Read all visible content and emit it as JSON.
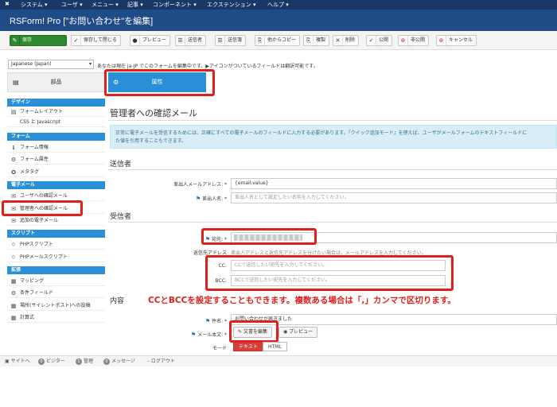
{
  "topmenu": {
    "logo_icon": "joomla-icon",
    "items": [
      "システム ▾",
      "ユーザ ▾",
      "メニュー ▾",
      "記事 ▾",
      "コンポーネント ▾",
      "エクステンション ▾",
      "ヘルプ ▾"
    ]
  },
  "titlebar": {
    "title": "RSForm! Pro [\"お問い合わせ\"を編集]"
  },
  "toolbar": {
    "buttons": [
      {
        "icon": "save-icon",
        "glyph": "✎",
        "label": "保存"
      },
      {
        "icon": "check-icon",
        "glyph": "✓",
        "label": "保存して閉じる"
      },
      {
        "icon": "preview-icon",
        "glyph": "●",
        "label": "プレビュー"
      },
      {
        "icon": "list-icon",
        "glyph": "☰",
        "label": "送信者"
      },
      {
        "icon": "list-icon",
        "glyph": "☰",
        "label": "送信簿"
      },
      {
        "icon": "copy-icon",
        "glyph": "⎘",
        "label": "他からコピー"
      },
      {
        "icon": "copy-icon",
        "glyph": "⎘",
        "label": "複製"
      },
      {
        "icon": "close-icon",
        "glyph": "✕",
        "label": "削除"
      },
      {
        "icon": "check-icon",
        "glyph": "✓",
        "label": "公開"
      },
      {
        "icon": "unpublish-icon",
        "glyph": "⊗",
        "label": "非公開"
      },
      {
        "icon": "cancel-icon",
        "glyph": "⊗",
        "label": "キャンセル"
      }
    ]
  },
  "language": {
    "selected": "Japanese (Japan)"
  },
  "info_text": "あなたは現在 ja-JP でこのフォームを編集中です。▶アイコンがついているフィールドは翻訳可能です。",
  "left": {
    "parts_tab": "部品",
    "sections": [
      {
        "title": "デザイン",
        "items": [
          {
            "icon": "layout-icon",
            "glyph": "▤",
            "label": "フォームレイアウト"
          },
          {
            "icon": "css-icon",
            "glyph": "",
            "label": "CSS と Javascript"
          }
        ]
      },
      {
        "title": "フォーム",
        "items": [
          {
            "icon": "info-icon",
            "glyph": "ℹ",
            "label": "フォーム情報"
          },
          {
            "icon": "gear-icon",
            "glyph": "⚙",
            "label": "フォーム属性"
          },
          {
            "icon": "globe-icon",
            "glyph": "✪",
            "label": "メタタグ"
          }
        ]
      },
      {
        "title": "電子メール",
        "items": [
          {
            "icon": "mail-icon",
            "glyph": "✉",
            "label": "ユーザへの確認メール"
          },
          {
            "icon": "mail-icon",
            "glyph": "✉",
            "label": "管理者への確認メール"
          },
          {
            "icon": "mail-icon",
            "glyph": "✉",
            "label": "追加の電子メール"
          }
        ]
      },
      {
        "title": "スクリプト",
        "items": [
          {
            "icon": "code-icon",
            "glyph": "⟨⟩",
            "label": "PHPスクリプト"
          },
          {
            "icon": "code-icon",
            "glyph": "⟨⟩",
            "label": "PHPメールスクリプト"
          }
        ]
      },
      {
        "title": "拡張",
        "items": [
          {
            "icon": "map-icon",
            "glyph": "▦",
            "label": "マッピング"
          },
          {
            "icon": "conditional-icon",
            "glyph": "⚙",
            "label": "条件フィールド"
          },
          {
            "icon": "post-icon",
            "glyph": "▦",
            "label": "場所(サイレントポスト)への投稿"
          },
          {
            "icon": "calculator-icon",
            "glyph": "▦",
            "label": "計算式"
          }
        ]
      }
    ]
  },
  "props_tab": "属性",
  "main": {
    "heading": "管理者への確認メール",
    "alert_line1": "正常に電子メールを受信するためには、正確にすべての電子メールのフィールドに入力する必要があります。『クイック追加モード』を使えば、ユーザがメールフォームのテキストフィールドに",
    "alert_line2": "た値を引用することもできます。",
    "sender_heading": "送信者",
    "from_label": "差出人メールアドレス: *",
    "from_value": "{email:value}",
    "fromname_label": "差出人名: *",
    "fromname_placeholder": "差出人名として設定したい名前を入力してください。",
    "recipient_heading": "受信者",
    "to_label": "宛先: *",
    "replyto_label": "返信先アドレス",
    "replyto_placeholder": "差出人アドレスと返信先アドレスを分けたい場合は、メールアドレスを入力してください。",
    "cc_label": "CC:",
    "cc_placeholder": "CCで送信したい宛先を入力してください。",
    "bcc_label": "BCC:",
    "bcc_placeholder": "BCCで送信したい宛先を入力してください。",
    "content_heading": "内容",
    "annotation": "CCとBCCを設定することもできます。複数ある場合は「,」カンマで区切ります。",
    "subject_label": "件名: *",
    "subject_value": "お問い合わせが届きました",
    "body_label": "メール本文: *",
    "edit_text_button": "文書を編集",
    "preview_button": "プレビュー",
    "mode_label": "モード",
    "mode_text": "テキスト",
    "mode_html": "HTML"
  },
  "statusbar": {
    "items": [
      {
        "icon": "site-icon",
        "badge": "",
        "label": "サイトへ"
      },
      {
        "icon": "visitor-icon",
        "badge": "0",
        "label": "ビジター"
      },
      {
        "icon": "admin-icon",
        "badge": "1",
        "label": "管理"
      },
      {
        "icon": "message-icon",
        "badge": "0",
        "label": "メッセージ"
      },
      {
        "icon": "logout-icon",
        "badge": "",
        "label": "ログアウト"
      }
    ]
  },
  "colors": {
    "accent": "#2a8fd6",
    "highlight": "#e0201b",
    "save": "#2f8a2f",
    "header": "#1f4b86"
  }
}
